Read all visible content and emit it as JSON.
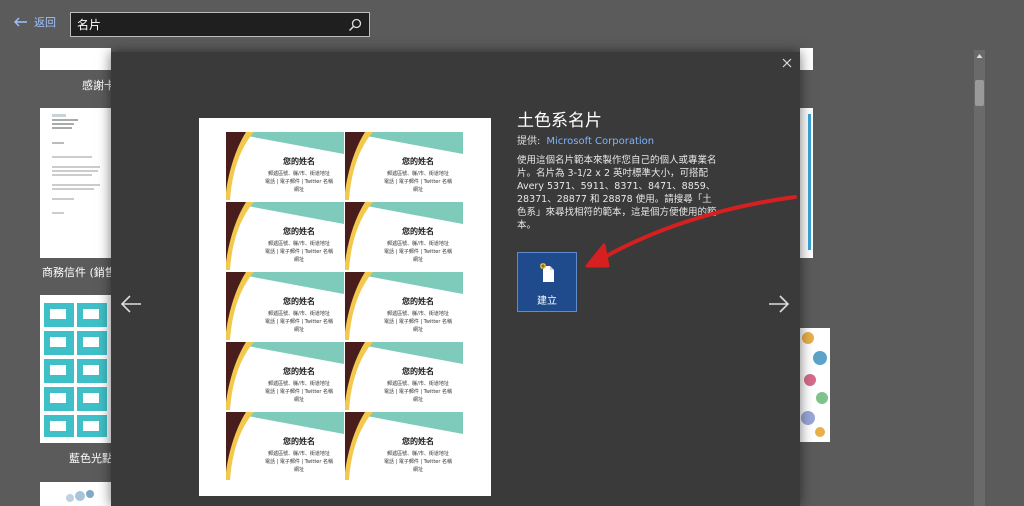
{
  "header": {
    "back_label": "返回",
    "search_value": "名片"
  },
  "background": {
    "labels": [
      "感謝卡",
      "商務信件 (銷售額",
      "藍色光點名"
    ]
  },
  "dialog": {
    "title": "土色系名片",
    "provider_label": "提供:",
    "provider_name": "Microsoft Corporation",
    "description": "使用這個名片範本來製作您自己的個人或專業名片。名片為 3-1/2 x 2 英吋標準大小，可搭配 Avery 5371、5911、8371、8471、8859、28371、28877 和 28878 使用。請搜尋「土色系」來尋找相符的範本，這是個方便使用的範本。",
    "create_label": "建立",
    "card": {
      "name": "您的姓名",
      "line1": "郵遞區號、縣/市、街道地址",
      "line2": "電話 | 電子郵件 | Twitter 名稱",
      "line3": "網址"
    }
  },
  "colors": {
    "teal": "#7ecbbc",
    "maroon": "#4a1d1d",
    "gold": "#f2c94c",
    "create_bg": "#1f4b8c",
    "arrow_red": "#d62020",
    "link_blue": "#7fb3ff"
  }
}
